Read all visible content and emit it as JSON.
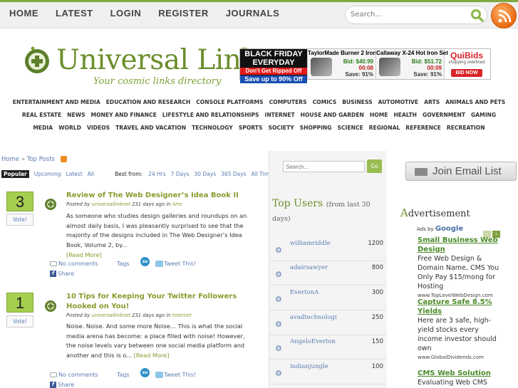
{
  "topnav": [
    "HOME",
    "LATEST",
    "LOGIN",
    "REGISTER",
    "JOURNALS"
  ],
  "search_top": {
    "placeholder": "Search..."
  },
  "logo": {
    "title": "Universal Link",
    "tagline": "Your cosmic links directory"
  },
  "banner_ad": {
    "bf": {
      "line1": "BLACK FRIDAY",
      "line1b": "EVERYDAY",
      "line2": "Don't Get Ripped Off",
      "line3": "Save up to 90% Off"
    },
    "products": [
      {
        "name": "TaylorMade Burner 2 Iron Set",
        "bid": "Bid: $40.99",
        "time": "00:08",
        "save": "Save: 91%"
      },
      {
        "name": "Callaway X-24 Hot Iron Set",
        "bid": "Bid: $51.72",
        "time": "00:09",
        "save": "Save: 91%"
      }
    ],
    "quibids": {
      "name": "QuiBids",
      "sub": "shopping redefined",
      "button": "BID NOW"
    }
  },
  "categories": {
    "row1": [
      "ENTERTAINMENT AND MEDIA",
      "EDUCATION AND RESEARCH",
      "CONSOLE PLATFORMS",
      "COMPUTERS",
      "COMICS",
      "BUSINESS",
      "AUTOMOTIVE",
      "ARTS",
      "ANIMALS AND PETS"
    ],
    "row2": [
      "REAL ESTATE",
      "NEWS",
      "MONEY AND FINANCE",
      "LIFESTYLE AND RELATIONSHIPS",
      "INTERNET",
      "HOUSE AND GARDEN",
      "HOME",
      "HEALTH",
      "GOVERNMENT",
      "GAMING"
    ],
    "row3": [
      "MEDIA",
      "WORLD",
      "VIDEOS",
      "TRAVEL AND VACATION",
      "TECHNOLOGY",
      "SPORTS",
      "SOCIETY",
      "SHOPPING",
      "SCIENCE",
      "REGIONAL",
      "REFERENCE",
      "RECREATION"
    ]
  },
  "breadcrumb": {
    "home": "Home",
    "sep": "»",
    "current": "Top Posts"
  },
  "tabs": {
    "items": [
      "Popular",
      "Upcoming",
      "Latest",
      "All"
    ],
    "best_from": "Best from:",
    "ranges": [
      "24 Hrs",
      "7 Days",
      "30 Days",
      "365 Days",
      "All Time"
    ]
  },
  "posts": [
    {
      "votes": "3",
      "vote_label": "Vote!",
      "title": "Review of The Web Designer’s Idea Book II",
      "meta_prefix": "Posted by",
      "author": "universallinknet",
      "when": "231 days ago in",
      "category": "Arts",
      "body": "As someone who studies design galleries and roundups on an almost daily basis, I was pleasantly surprised to see that the majority of the designs included in The Web Designer’s Idea Book, Volume 2, by...",
      "more": "[Read More]",
      "comments": "No comments",
      "tags": "Tags",
      "tweet": "Tweet This!",
      "share": "Share"
    },
    {
      "votes": "1",
      "vote_label": "Vote!",
      "title": "10 Tips for Keeping Your Twitter Followers Hooked on You!",
      "meta_prefix": "Posted by",
      "author": "universallinknet",
      "when": "231 days ago in",
      "category": "Internet",
      "body": "Noise. Noise. And some more Noise… This is what the social media arena has become: a place filled with noise! However, the noise levels vary between one social media platform and another and this is o...",
      "more": "[Read More]",
      "comments": "No comments",
      "tags": "Tags",
      "tweet": "Tweet This!",
      "share": "Share"
    }
  ],
  "mid_search": {
    "placeholder": "Search...",
    "button": "Go"
  },
  "top_users": {
    "title": "Top Users",
    "subtitle": "(from last 30 days)",
    "users": [
      {
        "name": "williamriddle",
        "score": "1200"
      },
      {
        "name": "adairsawyer",
        "score": "800"
      },
      {
        "name": "EvertonA",
        "score": "300"
      },
      {
        "name": "avadtechnologi",
        "score": "250"
      },
      {
        "name": "AngeloEverton",
        "score": "150"
      },
      {
        "name": "indianjungle",
        "score": "100"
      }
    ]
  },
  "email_button": "Join Email List",
  "advertisement": {
    "title_first": "A",
    "title_rest": "dvertisement",
    "ads_by": "Ads by",
    "google": "Google",
    "ads": [
      {
        "title": "Small Business Web Design",
        "desc": "Free Web Design & Domain Name, CMS You Only Pay $15/mong for Hosting",
        "url": "www.TopLevelWebDesign.com"
      },
      {
        "title": "Capture Safe 8.5% Yields",
        "desc": "Here are 3 safe, high-yield stocks every income investor should own",
        "url": "www.GlobalDividends.com"
      },
      {
        "title": "CMS Web Solution",
        "desc": "Evaluating Web CMS",
        "url": ""
      }
    ]
  },
  "colors": {
    "accent_green": "#7fa93f",
    "link_blue": "#5a7cb2",
    "title_olive": "#8a9b2e"
  }
}
